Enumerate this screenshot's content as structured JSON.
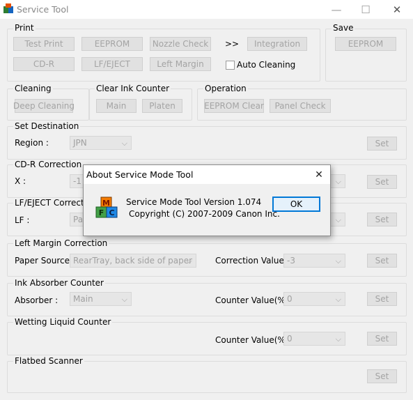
{
  "window": {
    "title": "Service Tool",
    "minimize": "—",
    "maximize": "☐",
    "close": "✕"
  },
  "print": {
    "label": "Print",
    "test_print": "Test Print",
    "eeprom": "EEPROM",
    "nozzle_check": "Nozzle Check",
    "arrow": ">>",
    "integration": "Integration",
    "cd_r": "CD-R",
    "lf_eject": "LF/EJECT",
    "left_margin": "Left Margin",
    "auto_cleaning": "Auto Cleaning"
  },
  "save": {
    "label": "Save",
    "eeprom": "EEPROM"
  },
  "cleaning": {
    "label": "Cleaning",
    "deep_cleaning": "Deep Cleaning"
  },
  "ink_counter": {
    "label": "Clear Ink Counter",
    "main": "Main",
    "platen": "Platen"
  },
  "operation": {
    "label": "Operation",
    "eeprom_clear": "EEPROM Clear",
    "panel_check": "Panel Check"
  },
  "set_destination": {
    "label": "Set Destination",
    "region_label": "Region :",
    "region_value": "JPN",
    "set": "Set"
  },
  "cdr_correction": {
    "label": "CD-R Correction",
    "x_label": "X :",
    "x_value": "-1",
    "set": "Set"
  },
  "lf_eject_correction": {
    "label": "LF/EJECT Correct",
    "lf_label": "LF :",
    "lf_value": "Pat",
    "set": "Set"
  },
  "left_margin_correction": {
    "label": "Left Margin Correction",
    "paper_source_label": "Paper Source :",
    "paper_source_value": "RearTray, back side of paper",
    "correction_label": "Correction Value :",
    "correction_value": "-3",
    "set": "Set"
  },
  "ink_absorber": {
    "label": "Ink Absorber Counter",
    "absorber_label": "Absorber :",
    "absorber_value": "Main",
    "counter_label": "Counter Value(%) :",
    "counter_value": "0",
    "set": "Set"
  },
  "wetting_liquid": {
    "label": "Wetting Liquid Counter",
    "counter_label": "Counter Value(%) :",
    "counter_value": "0",
    "set": "Set"
  },
  "flatbed": {
    "label": "Flatbed Scanner",
    "set": "Set"
  },
  "about_dialog": {
    "title": "About Service Mode Tool",
    "close": "✕",
    "line1": "Service Mode Tool  Version 1.074",
    "line2": "Copyright (C) 2007-2009 Canon Inc.",
    "ok": "OK",
    "icon_letters": [
      "M",
      "F",
      "C"
    ]
  }
}
